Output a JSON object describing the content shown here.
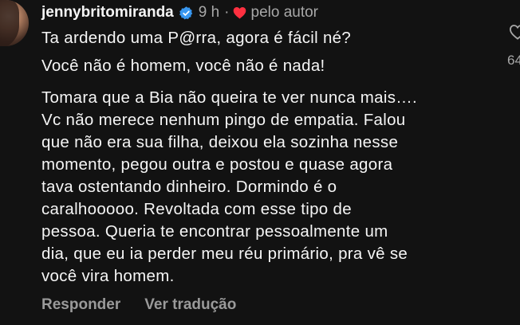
{
  "comment": {
    "username": "jennybritomiranda",
    "time": "9 h",
    "separator": "·",
    "liked_by_label": "pelo autor",
    "line1": "Ta ardendo uma P@rra, agora é fácil né?",
    "line2": "Você não é homem, você não é nada!",
    "paragraph": "Tomara que a Bia não queira te ver nunca mais….\nVc não merece nenhum pingo de empatia. Falou\nque não era sua filha, deixou ela sozinha nesse\nmomento, pegou outra e postou e quase agora\ntava ostentando dinheiro. Dormindo é o\ncaralhooooo. Revoltada com esse tipo de\npessoa. Queria te encontrar pessoalmente  um\ndia, que eu ia perder meu réu primário, pra vê se\nvocê vira homem."
  },
  "actions": {
    "reply_label": "Responder",
    "translate_label": "Ver tradução"
  },
  "likes": {
    "count": "64"
  },
  "icons": {
    "verified": "verified-badge-icon",
    "heart": "heart-icon",
    "like": "like-heart-outline-icon"
  },
  "colors": {
    "background": "#121212",
    "verified": "#3897f0",
    "heart": "#ff3040",
    "muted": "#a8a8a8"
  }
}
